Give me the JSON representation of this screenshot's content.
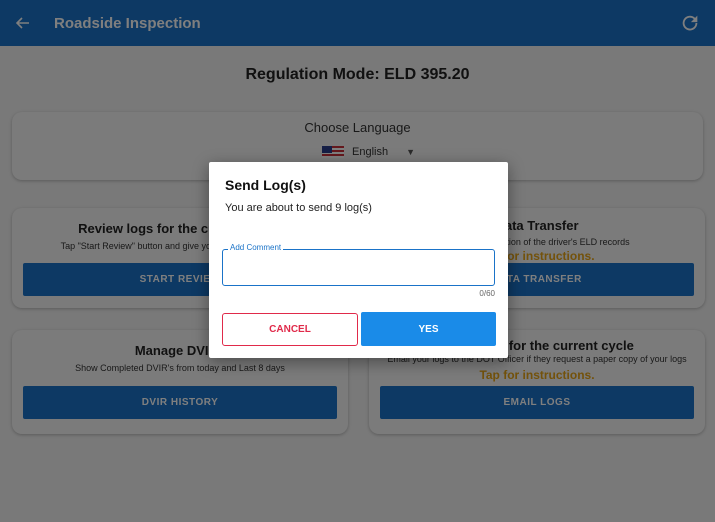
{
  "appbar": {
    "title": "Roadside Inspection"
  },
  "regulation_mode": "Regulation Mode: ELD 395.20",
  "language": {
    "label": "Choose Language",
    "selected": "English"
  },
  "cards": {
    "review": {
      "title": "Review logs for the current cycle",
      "subtitle": "Tap \"Start Review\" button and give your device to the officer",
      "button": "START REVIEW"
    },
    "transfer": {
      "title": "Data Transfer",
      "subtitle": "Send a compilation of the driver's ELD records",
      "tap": "Tap for instructions.",
      "button": "DATA TRANSFER"
    },
    "dvir": {
      "title": "Manage DVIRs",
      "subtitle": "Show Completed DVIR's from today and Last 8 days",
      "button": "DVIR HISTORY"
    },
    "email": {
      "title": "Email logs for the current cycle",
      "subtitle": "Email your logs to the DOT Officer if they request a paper copy of your logs",
      "tap": "Tap for instructions.",
      "button": "EMAIL LOGS"
    }
  },
  "dialog": {
    "title": "Send Log(s)",
    "message": "You are about to send 9 log(s)",
    "comment_label": "Add Comment",
    "comment_value": "",
    "counter": "0/60",
    "cancel": "CANCEL",
    "yes": "YES"
  },
  "colors": {
    "primary": "#1a73c8",
    "accent": "#e6a417",
    "cancel": "#e02a4a"
  },
  "icons": {
    "back": "arrow-left",
    "refresh": "refresh",
    "flag": "us-flag",
    "dropdown": "caret-down"
  }
}
